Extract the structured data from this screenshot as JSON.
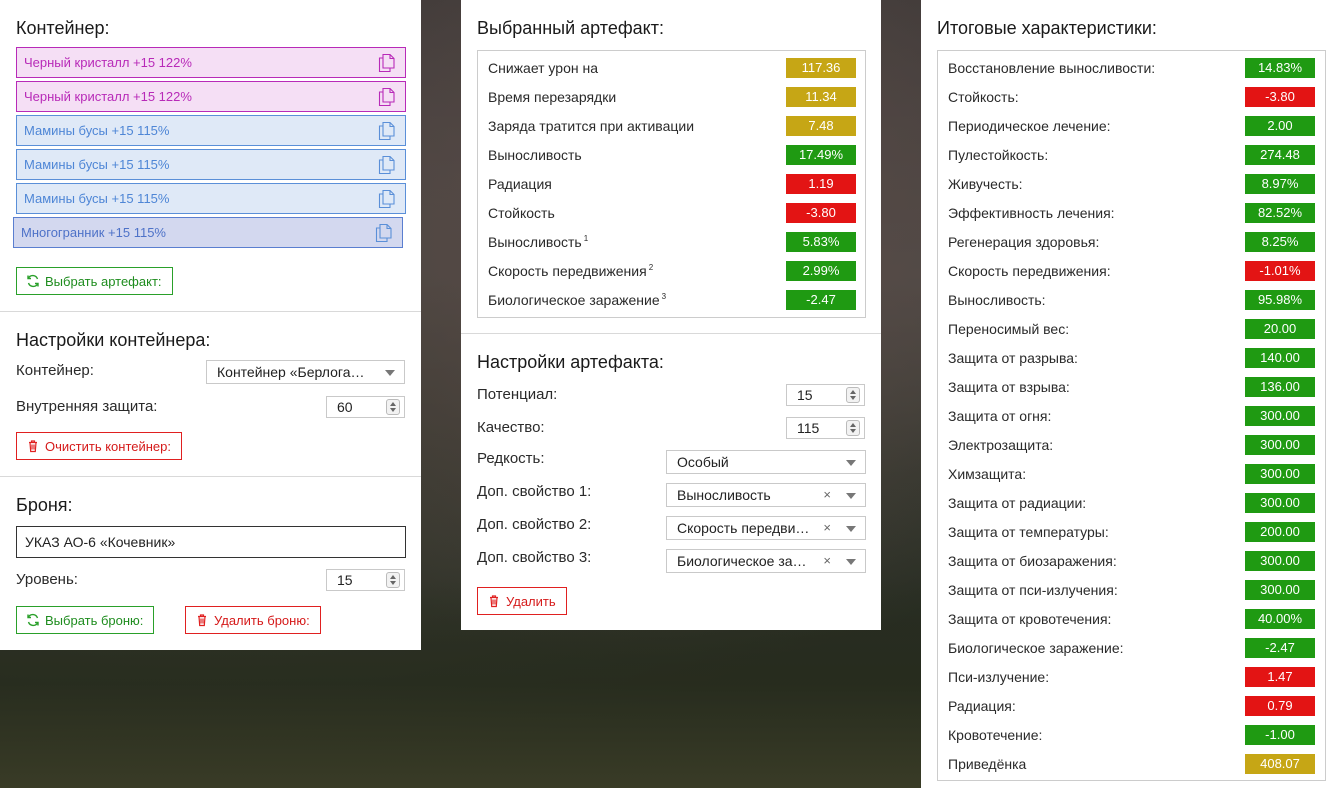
{
  "colors": {
    "green": "#1f9a12",
    "red": "#e31414",
    "gold": "#c6a615",
    "purple": "#b82ab8",
    "blue": "#4e86d6"
  },
  "container": {
    "title": "Контейнер:",
    "items": [
      {
        "label": "Черный кристалл +15 122%",
        "style": "purple"
      },
      {
        "label": "Черный кристалл +15 122%",
        "style": "purple"
      },
      {
        "label": "Мамины бусы +15 115%",
        "style": "blue"
      },
      {
        "label": "Мамины бусы +15 115%",
        "style": "blue"
      },
      {
        "label": "Мамины бусы +15 115%",
        "style": "blue"
      },
      {
        "label": "Многогранник +15 115%",
        "style": "indigo"
      }
    ],
    "item_icon": "copy-icon",
    "select_artifact_label": "Выбрать артефакт:"
  },
  "container_settings": {
    "title": "Настройки контейнера:",
    "container_label": "Контейнер:",
    "container_value": "Контейнер «Берлога…",
    "protection_label": "Внутренняя защита:",
    "protection_value": "60",
    "clear_label": "Очистить контейнер:"
  },
  "armor": {
    "title": "Броня:",
    "name_value": "УКАЗ АО-6 «Кочевник»",
    "level_label": "Уровень:",
    "level_value": "15",
    "select_label": "Выбрать броню:",
    "delete_label": "Удалить броню:"
  },
  "selected_artifact": {
    "title": "Выбранный артефакт:",
    "stats": [
      {
        "name": "Снижает урон на",
        "sup": "",
        "value": "117.36",
        "color": "gold"
      },
      {
        "name": "Время перезарядки",
        "sup": "",
        "value": "11.34",
        "color": "gold"
      },
      {
        "name": "Заряда тратится при активации",
        "sup": "",
        "value": "7.48",
        "color": "gold"
      },
      {
        "name": "Выносливость",
        "sup": "",
        "value": "17.49%",
        "color": "green"
      },
      {
        "name": "Радиация",
        "sup": "",
        "value": "1.19",
        "color": "red"
      },
      {
        "name": "Стойкость",
        "sup": "",
        "value": "-3.80",
        "color": "red"
      },
      {
        "name": "Выносливость",
        "sup": "1",
        "value": "5.83%",
        "color": "green"
      },
      {
        "name": "Скорость передвижения",
        "sup": "2",
        "value": "2.99%",
        "color": "green"
      },
      {
        "name": "Биологическое заражение",
        "sup": "3",
        "value": "-2.47",
        "color": "green"
      }
    ]
  },
  "artifact_settings": {
    "title": "Настройки артефакта:",
    "potential_label": "Потенциал:",
    "potential_value": "15",
    "quality_label": "Качество:",
    "quality_value": "115",
    "rarity_label": "Редкость:",
    "rarity_value": "Особый",
    "extra1_label": "Доп. свойство 1:",
    "extra1_value": "Выносливость",
    "extra2_label": "Доп. свойство 2:",
    "extra2_value": "Скорость передви…",
    "extra3_label": "Доп. свойство 3:",
    "extra3_value": "Биологическое за…",
    "clear_glyph": "×",
    "delete_label": "Удалить"
  },
  "totals": {
    "title": "Итоговые характеристики:",
    "stats": [
      {
        "name": "Восстановление выносливости:",
        "value": "14.83%",
        "color": "green"
      },
      {
        "name": "Стойкость:",
        "value": "-3.80",
        "color": "red"
      },
      {
        "name": "Периодическое лечение:",
        "value": "2.00",
        "color": "green"
      },
      {
        "name": "Пулестойкость:",
        "value": "274.48",
        "color": "green"
      },
      {
        "name": "Живучесть:",
        "value": "8.97%",
        "color": "green"
      },
      {
        "name": "Эффективность лечения:",
        "value": "82.52%",
        "color": "green"
      },
      {
        "name": "Регенерация здоровья:",
        "value": "8.25%",
        "color": "green"
      },
      {
        "name": "Скорость передвижения:",
        "value": "-1.01%",
        "color": "red"
      },
      {
        "name": "Выносливость:",
        "value": "95.98%",
        "color": "green"
      },
      {
        "name": "Переносимый вес:",
        "value": "20.00",
        "color": "green"
      },
      {
        "name": "Защита от разрыва:",
        "value": "140.00",
        "color": "green"
      },
      {
        "name": "Защита от взрыва:",
        "value": "136.00",
        "color": "green"
      },
      {
        "name": "Защита от огня:",
        "value": "300.00",
        "color": "green"
      },
      {
        "name": "Электрозащита:",
        "value": "300.00",
        "color": "green"
      },
      {
        "name": "Химзащита:",
        "value": "300.00",
        "color": "green"
      },
      {
        "name": "Защита от радиации:",
        "value": "300.00",
        "color": "green"
      },
      {
        "name": "Защита от температуры:",
        "value": "200.00",
        "color": "green"
      },
      {
        "name": "Защита от биозаражения:",
        "value": "300.00",
        "color": "green"
      },
      {
        "name": "Защита от пси-излучения:",
        "value": "300.00",
        "color": "green"
      },
      {
        "name": "Защита от кровотечения:",
        "value": "40.00%",
        "color": "green"
      },
      {
        "name": "Биологическое заражение:",
        "value": "-2.47",
        "color": "green"
      },
      {
        "name": "Пси-излучение:",
        "value": "1.47",
        "color": "red"
      },
      {
        "name": "Радиация:",
        "value": "0.79",
        "color": "red"
      },
      {
        "name": "Кровотечение:",
        "value": "-1.00",
        "color": "green"
      },
      {
        "name": "Приведёнка",
        "value": "408.07",
        "color": "gold"
      }
    ]
  }
}
